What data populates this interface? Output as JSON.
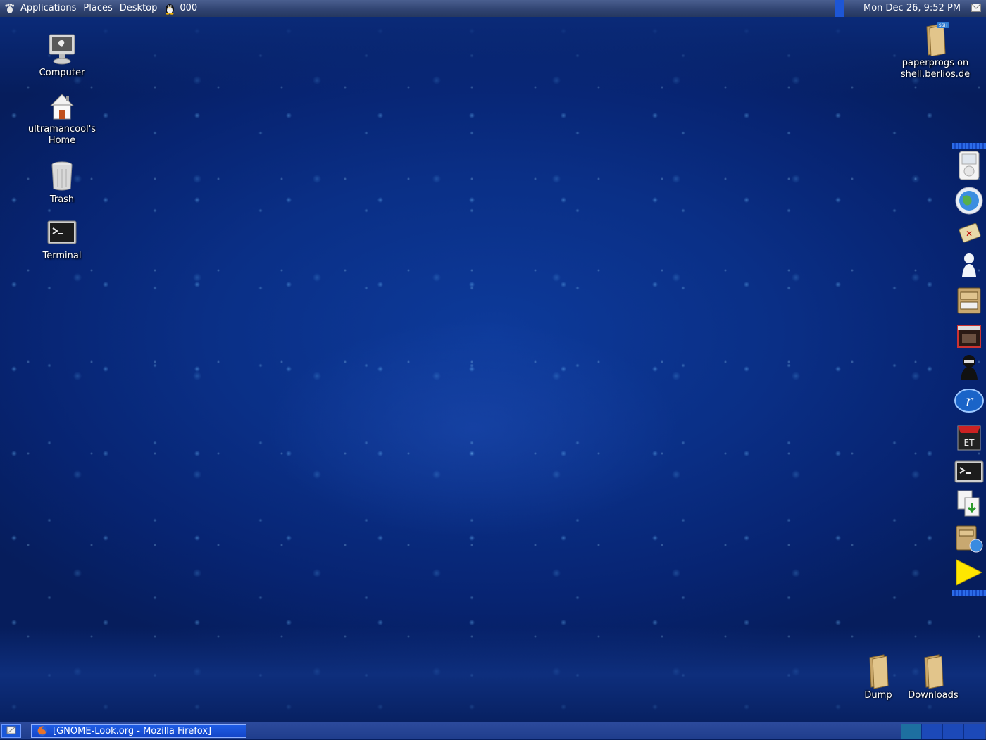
{
  "top_panel": {
    "menus": [
      "Applications",
      "Places",
      "Desktop"
    ],
    "icons": [
      "gnome-foot-icon",
      "tux-penguin-icon",
      "mail-icon"
    ],
    "tux_label": "000",
    "clock": "Mon Dec 26,  9:52 PM"
  },
  "desktop_icons": {
    "computer": "Computer",
    "home_line1": "ultramancool's",
    "home_line2": "Home",
    "trash": "Trash",
    "terminal": "Terminal",
    "ssh_line1": "paperprogs on",
    "ssh_line2": "shell.berlios.de",
    "ssh_badge": "SSH",
    "dump": "Dump",
    "downloads": "Downloads"
  },
  "dock": {
    "items": [
      "ipod-icon",
      "globe-browser-icon",
      "mahjongg-icon",
      "messenger-icon",
      "file-cabinet-icon",
      "video-clapper-icon",
      "ninja-icon",
      "realplayer-icon",
      "enemy-territory-icon",
      "terminal-icon",
      "file-transfer-icon",
      "network-server-icon",
      "play-arrow-icon"
    ]
  },
  "taskbar": {
    "window_title": "[GNOME-Look.org - Mozilla Firefox]",
    "workspaces": 4,
    "active_workspace": 1
  },
  "colors": {
    "panel": "#2f4270",
    "task_button": "#1f5ee6",
    "desktop": "#0a2f86"
  }
}
